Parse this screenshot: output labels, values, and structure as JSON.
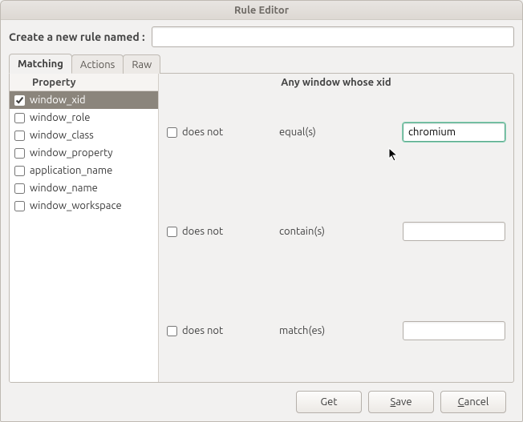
{
  "window": {
    "title": "Rule Editor"
  },
  "form": {
    "create_label": "Create a new rule named :",
    "rule_name": ""
  },
  "tabs": [
    {
      "label": "Matching",
      "active": true
    },
    {
      "label": "Actions",
      "active": false
    },
    {
      "label": "Raw",
      "active": false
    }
  ],
  "properties": {
    "header": "Property",
    "items": [
      {
        "name": "window_xid",
        "checked": true,
        "selected": true
      },
      {
        "name": "window_role",
        "checked": false,
        "selected": false
      },
      {
        "name": "window_class",
        "checked": false,
        "selected": false
      },
      {
        "name": "window_property",
        "checked": false,
        "selected": false
      },
      {
        "name": "application_name",
        "checked": false,
        "selected": false
      },
      {
        "name": "window_name",
        "checked": false,
        "selected": false
      },
      {
        "name": "window_workspace",
        "checked": false,
        "selected": false
      }
    ]
  },
  "matcher": {
    "header": "Any window whose xid",
    "rows": [
      {
        "negate": false,
        "negate_label": "does not",
        "op": "equal(s)",
        "value": "chromium",
        "focused": true
      },
      {
        "negate": false,
        "negate_label": "does not",
        "op": "contain(s)",
        "value": "",
        "focused": false
      },
      {
        "negate": false,
        "negate_label": "does not",
        "op": "match(es)",
        "value": "",
        "focused": false
      }
    ]
  },
  "buttons": {
    "get": "Get",
    "save_pre": "",
    "save_mn": "S",
    "save_post": "ave",
    "cancel_pre": "",
    "cancel_mn": "C",
    "cancel_post": "ancel"
  }
}
